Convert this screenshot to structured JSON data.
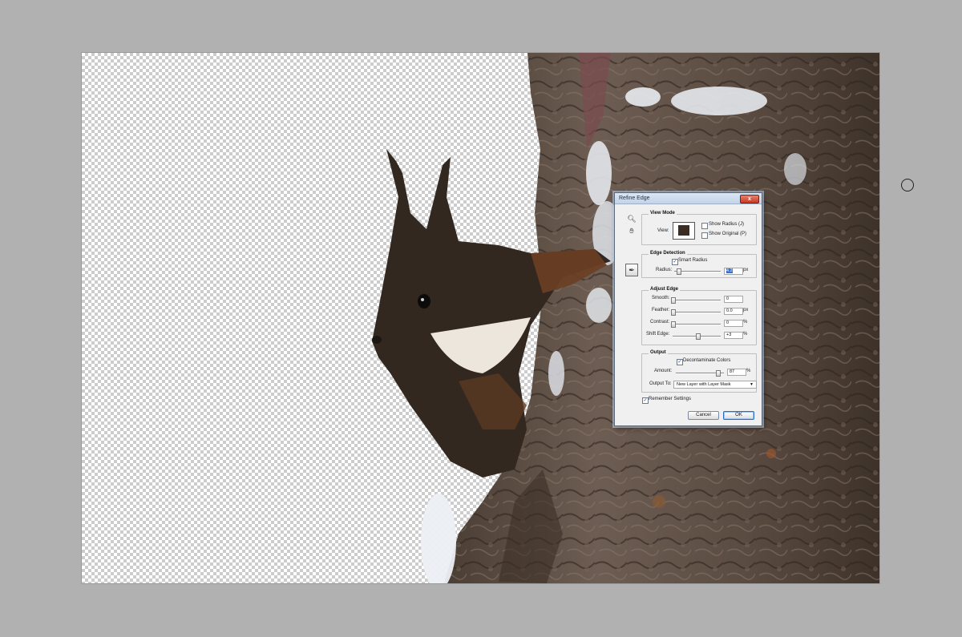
{
  "dialog": {
    "title": "Refine Edge",
    "close_glyph": "x",
    "view_mode": {
      "title": "View Mode",
      "view_label": "View:",
      "show_radius_label": "Show Radius (J)",
      "show_radius_checked": false,
      "show_original_label": "Show Original (P)",
      "show_original_checked": false
    },
    "edge_detection": {
      "title": "Edge Detection",
      "smart_radius_label": "Smart Radius",
      "smart_radius_checked": true,
      "radius_label": "Radius:",
      "radius_value": "4.2",
      "radius_unit": "px",
      "radius_level": 0.08
    },
    "adjust_edge": {
      "title": "Adjust Edge",
      "smooth_label": "Smooth:",
      "smooth_value": "0",
      "smooth_level": 0.0,
      "feather_label": "Feather:",
      "feather_value": "0.0",
      "feather_unit": "px",
      "feather_level": 0.0,
      "contrast_label": "Contrast:",
      "contrast_value": "0",
      "contrast_unit": "%",
      "contrast_level": 0.0,
      "shift_edge_label": "Shift Edge:",
      "shift_edge_value": "+3",
      "shift_edge_unit": "%",
      "shift_edge_level": 0.515
    },
    "output": {
      "title": "Output",
      "decontaminate_label": "Decontaminate Colors",
      "decontaminate_checked": true,
      "amount_label": "Amount:",
      "amount_value": "87",
      "amount_unit": "%",
      "amount_level": 0.87,
      "output_to_label": "Output To:",
      "output_to_value": "New Layer with Layer Mask"
    },
    "remember_settings_label": "Remember Settings",
    "remember_settings_checked": true,
    "cancel_label": "Cancel",
    "ok_label": "OK"
  },
  "icons": {
    "zoom": "magnifier-icon",
    "hand": "hand-icon",
    "refine_radius": "refine-radius-brush-icon",
    "brush_cursor": "brush-cursor-icon"
  },
  "colors": {
    "workspace_bg": "#b1b1b1",
    "checker": "#cccccc",
    "selection_highlight": "#3a6ccb"
  }
}
